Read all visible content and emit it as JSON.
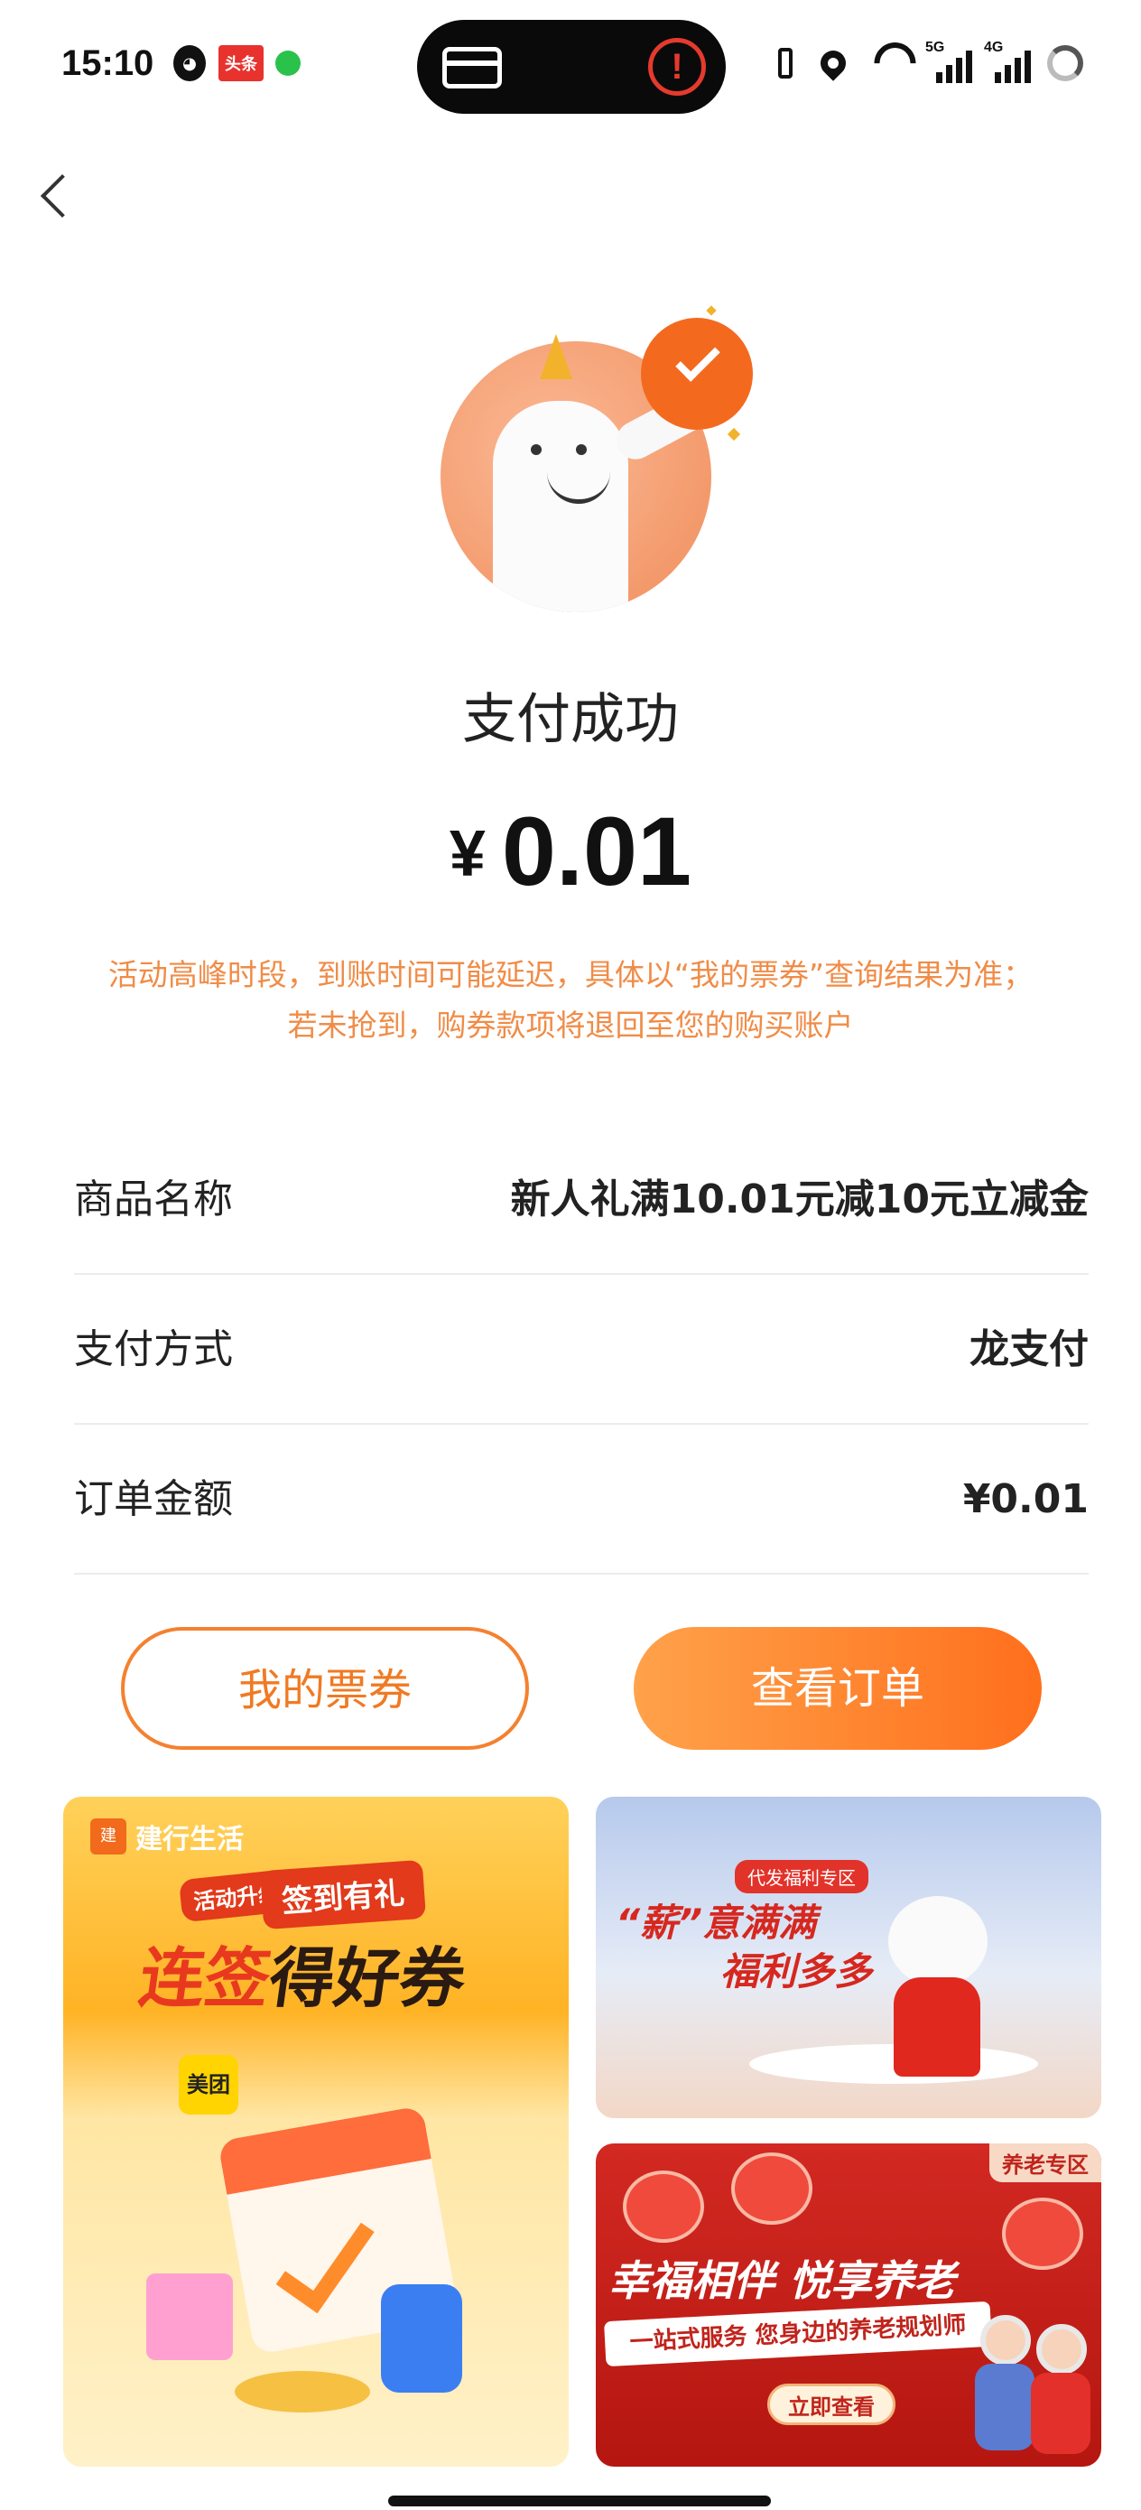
{
  "status_bar": {
    "time": "15:10",
    "toutiao_label": "头条",
    "signal_5g": "5G",
    "signal_4g": "4G"
  },
  "icons": {
    "back": "chevron-left-icon",
    "success": "check-circle-icon"
  },
  "result": {
    "title": "支付成功",
    "currency": "¥",
    "amount": "0.01",
    "notice_line1": "活动高峰时段，到账时间可能延迟，具体以“我的票券”查询结果为准；",
    "notice_line2": "若未抢到，购券款项将退回至您的购买账户"
  },
  "details": [
    {
      "label": "商品名称",
      "value": "新人礼满10.01元减10元立减金"
    },
    {
      "label": "支付方式",
      "value": "龙支付"
    },
    {
      "label": "订单金额",
      "value": "¥0.01"
    }
  ],
  "buttons": {
    "my_tickets": "我的票券",
    "view_order": "查看订单"
  },
  "banners": {
    "checkin": {
      "brand": "建行生活",
      "tag_small": "活动升级",
      "tag": "签到有礼",
      "headline_a": "连签",
      "headline_b": "得好券",
      "meituan": "美团"
    },
    "salary": {
      "tag": "代发福利专区",
      "line1": "“薪”意满满",
      "line2": "福利多多"
    },
    "elderly": {
      "tag": "养老专区",
      "headline": "幸福相伴 悦享养老",
      "subline": "一站式服务 您身边的养老规划师",
      "cta": "立即查看"
    }
  },
  "colors": {
    "accent": "#f4812f",
    "notice": "#f08c47",
    "banner_red": "#d22922"
  }
}
